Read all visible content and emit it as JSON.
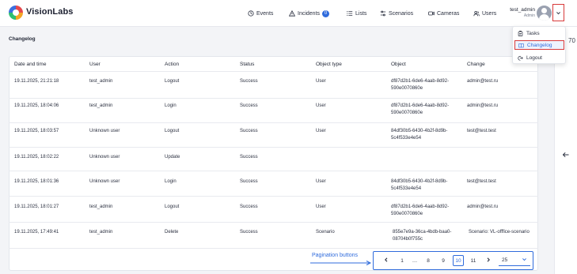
{
  "brand": {
    "name": "VisionLabs"
  },
  "nav": [
    {
      "label": "Events",
      "icon": "clock-icon"
    },
    {
      "label": "Incidents",
      "icon": "warning-icon",
      "badge": "0"
    },
    {
      "label": "Lists",
      "icon": "lists-icon"
    },
    {
      "label": "Scenarios",
      "icon": "sliders-icon"
    },
    {
      "label": "Cameras",
      "icon": "camera-icon"
    },
    {
      "label": "Users",
      "icon": "users-icon"
    }
  ],
  "user": {
    "name": "test_admin",
    "role": "Admin"
  },
  "user_menu": {
    "items": [
      {
        "label": "Tasks",
        "icon": "tasks-icon"
      },
      {
        "label": "Changelog",
        "icon": "changelog-icon",
        "selected": true
      },
      {
        "label": "Logout",
        "icon": "logout-icon"
      }
    ]
  },
  "page": {
    "title": "Changelog"
  },
  "right_rail": {
    "text": "70"
  },
  "table": {
    "columns": [
      "Date and time",
      "User",
      "Action",
      "Status",
      "Object type",
      "Object",
      "Change"
    ],
    "rows": [
      {
        "datetime": "19.11.2025, 21:21:18",
        "user": "test_admin",
        "action": "Logout",
        "status": "Success",
        "object_type": "User",
        "object": "df87d2b1-6de6-4aab-8d92-590e0070860e",
        "change": "admin@test.ru"
      },
      {
        "datetime": "19.11.2025, 18:04:06",
        "user": "test_admin",
        "action": "Login",
        "status": "Success",
        "object_type": "User",
        "object": "df87d2b1-6de6-4aab-8d92-590e0070860e",
        "change": "admin@test.ru"
      },
      {
        "datetime": "19.11.2025, 18:03:57",
        "user": "Unknown user",
        "action": "Logout",
        "status": "Success",
        "object_type": "User",
        "object": "84df30b5-6430-4b2f-8d9b-5c4f533e4e54",
        "change": "test@test.test"
      },
      {
        "datetime": "19.11.2025, 18:02:22",
        "user": "Unknown user",
        "action": "Update",
        "status": "Success",
        "object_type": "",
        "object": "",
        "change": ""
      },
      {
        "datetime": "19.11.2025, 18:01:36",
        "user": "Unknown user",
        "action": "Login",
        "status": "Success",
        "object_type": "User",
        "object": "84df30b5-6430-4b2f-8d9b-5c4f533e4e54",
        "change": "test@test.test"
      },
      {
        "datetime": "19.11.2025, 18:01:27",
        "user": "test_admin",
        "action": "Logout",
        "status": "Success",
        "object_type": "User",
        "object": "df87d2b1-6de6-4aab-8d92-590e0070860e",
        "change": "admin@test.ru"
      },
      {
        "datetime": "19.11.2025, 17:49:41",
        "user": "test_admin",
        "action": "Delete",
        "status": "Success",
        "object_type": "Scenario",
        "object": "855e7e9a-36ca-4bdb-baa0-08704b0f755c",
        "change": "Scenario: VL-offfice-scenario"
      }
    ]
  },
  "pagination": {
    "annotation": "Pagination buttons",
    "pages": [
      "1",
      "…",
      "8",
      "9",
      "10",
      "11"
    ],
    "current": "10",
    "page_size": "25"
  },
  "colors": {
    "accent": "#2f6bdc",
    "highlight": "#d83a3a"
  }
}
